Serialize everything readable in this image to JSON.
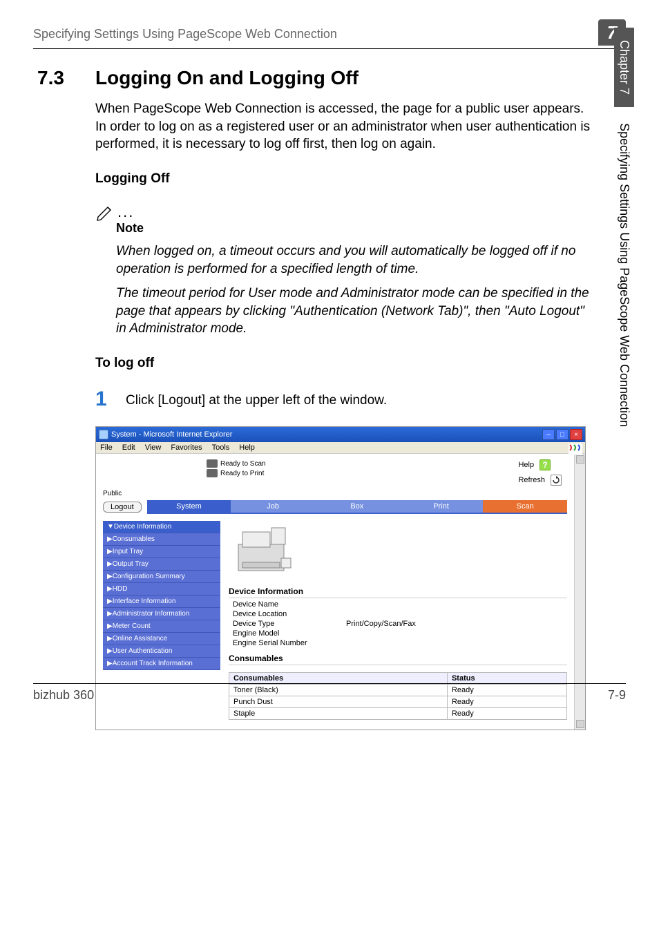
{
  "header": {
    "running_title": "Specifying Settings Using PageScope Web Connection",
    "chapter_tab": "7"
  },
  "side": {
    "chapter": "Chapter 7",
    "title": "Specifying Settings Using PageScope Web Connection"
  },
  "section": {
    "number": "7.3",
    "title": "Logging On and Logging Off",
    "intro": "When PageScope Web Connection is accessed, the page for a public user appears. In order to log on as a registered user or an administrator when user authentication is performed, it is necessary to log off first, then log on again.",
    "sub_logging_off": "Logging Off",
    "note_label": "Note",
    "note_p1": "When logged on, a timeout occurs and you will automatically be logged off if no operation is performed for a specified length of time.",
    "note_p2": "The timeout period for User mode and Administrator mode can be specified in the page that appears by clicking \"Authentication (Network Tab)\", then \"Auto Logout\" in Administrator mode.",
    "sub_to_log_off": "To log off",
    "step1_num": "1",
    "step1_text": "Click [Logout] at the upper left of the window."
  },
  "screenshot": {
    "window_title": "System - Microsoft Internet Explorer",
    "menu": [
      "File",
      "Edit",
      "View",
      "Favorites",
      "Tools",
      "Help"
    ],
    "status": {
      "scan": "Ready to Scan",
      "print": "Ready to Print"
    },
    "help": "Help",
    "refresh": "Refresh",
    "public": "Public",
    "logout": "Logout",
    "tabs": {
      "system": "System",
      "job": "Job",
      "box": "Box",
      "print": "Print",
      "scan": "Scan"
    },
    "sidebar": [
      "▼Device Information",
      "▶Consumables",
      "▶Input Tray",
      "▶Output Tray",
      "▶Configuration Summary",
      "▶HDD",
      "▶Interface Information",
      "▶Administrator Information",
      "▶Meter Count",
      "▶Online Assistance",
      "▶User Authentication",
      "▶Account Track Information"
    ],
    "device_info_heading": "Device Information",
    "device_info": [
      {
        "k": "Device Name",
        "v": ""
      },
      {
        "k": "Device Location",
        "v": ""
      },
      {
        "k": "Device Type",
        "v": "Print/Copy/Scan/Fax"
      },
      {
        "k": "Engine Model",
        "v": ""
      },
      {
        "k": "Engine Serial Number",
        "v": ""
      }
    ],
    "consumables_heading": "Consumables",
    "consumables_headers": {
      "c1": "Consumables",
      "c2": "Status"
    },
    "consumables": [
      {
        "name": "Toner (Black)",
        "status": "Ready"
      },
      {
        "name": "Punch Dust",
        "status": "Ready"
      },
      {
        "name": "Staple",
        "status": "Ready"
      }
    ]
  },
  "footer": {
    "left": "bizhub 360",
    "right": "7-9"
  }
}
